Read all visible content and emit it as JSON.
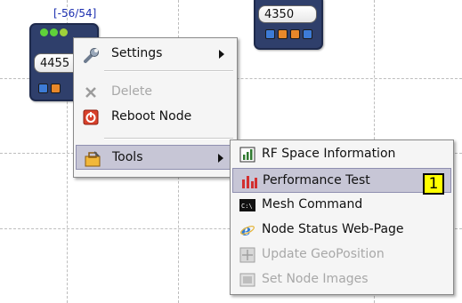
{
  "nodes": [
    {
      "value": "4455",
      "link_label": "[-56/54]"
    },
    {
      "value": "4350"
    }
  ],
  "context_menu": {
    "items": [
      {
        "label": "Settings",
        "icon": "wrench-icon",
        "submenu": true,
        "enabled": true
      },
      {
        "label": "Delete",
        "icon": "delete-x-icon",
        "submenu": false,
        "enabled": false
      },
      {
        "label": "Reboot Node",
        "icon": "reboot-icon",
        "submenu": false,
        "enabled": true
      },
      {
        "label": "Tools",
        "icon": "toolbox-icon",
        "submenu": true,
        "enabled": true,
        "highlighted": true
      }
    ]
  },
  "tools_submenu": {
    "items": [
      {
        "label": "RF Space Information",
        "icon": "bar-chart-icon",
        "enabled": true
      },
      {
        "label": "Performance Test",
        "icon": "performance-chart-icon",
        "enabled": true,
        "highlighted": true
      },
      {
        "label": "Mesh Command",
        "icon": "terminal-icon",
        "enabled": true
      },
      {
        "label": "Node Status Web-Page",
        "icon": "internet-explorer-icon",
        "enabled": true
      },
      {
        "label": "Update GeoPosition",
        "icon": "geoposition-icon",
        "enabled": false
      },
      {
        "label": "Set Node Images",
        "icon": "image-icon",
        "enabled": false
      }
    ]
  },
  "annotation": {
    "marker": "1",
    "color": "#ffff00"
  }
}
